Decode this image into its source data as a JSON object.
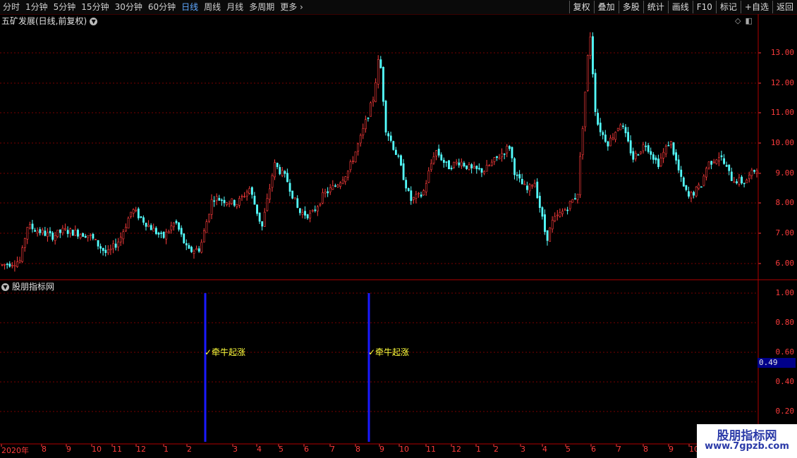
{
  "toolbar": {
    "periods": [
      "分时",
      "1分钟",
      "5分钟",
      "15分钟",
      "30分钟",
      "60分钟",
      "日线",
      "周线",
      "月线",
      "多周期",
      "更多"
    ],
    "active_period": "日线",
    "more_chevron": "›",
    "buttons": [
      "复权",
      "叠加",
      "多股",
      "统计",
      "画线",
      "F10",
      "标记",
      "+自选",
      "返回"
    ]
  },
  "main_chart": {
    "title": "五矿发展(日线,前复权)",
    "icons": [
      "chevron-down-icon",
      "diamond-icon",
      "panel-toggle-icon"
    ]
  },
  "indicator": {
    "title": "股朋指标网",
    "current_value": "0.49",
    "signal_label": "牵牛起涨",
    "signal_check": "✓"
  },
  "watermark": {
    "title": "股朋指标网",
    "url": "www.7gpzb.com"
  },
  "colors": {
    "up": "#ff3c3c",
    "down": "#54ffff",
    "axis": "#ff3c3c",
    "grid": "#7a0000",
    "signal_bar": "#1a1aff",
    "signal_text": "#ffff3c",
    "active_period": "#5fa8ff"
  },
  "chart_data": [
    {
      "type": "candlestick",
      "title": "五矿发展(日线,前复权)",
      "y_ticks": [
        "13.00",
        "12.00",
        "11.00",
        "10.00",
        "9.00",
        "8.00",
        "7.00",
        "6.00"
      ],
      "ylim": [
        5.6,
        14.0
      ],
      "x_tick_labels": [
        "2020年",
        "8",
        "9",
        "10",
        "11",
        "12",
        "1",
        "2",
        "3",
        "4",
        "5",
        "6",
        "7",
        "8",
        "9",
        "10",
        "11",
        "12",
        "1",
        "2",
        "3",
        "4",
        "5",
        "6",
        "7",
        "8",
        "9",
        "10",
        "1"
      ],
      "price_path": [
        [
          0,
          5.95
        ],
        [
          3,
          6.1
        ],
        [
          4,
          7.25
        ],
        [
          8,
          6.9
        ],
        [
          10,
          7.1
        ],
        [
          14,
          6.95
        ],
        [
          17,
          6.3
        ],
        [
          19,
          6.8
        ],
        [
          21,
          7.8
        ],
        [
          24,
          7.2
        ],
        [
          26,
          6.85
        ],
        [
          28,
          7.4
        ],
        [
          30,
          6.4
        ],
        [
          32,
          6.5
        ],
        [
          34,
          8.2
        ],
        [
          38,
          8.0
        ],
        [
          40,
          8.5
        ],
        [
          42,
          7.2
        ],
        [
          44,
          9.3
        ],
        [
          46,
          8.8
        ],
        [
          48,
          7.7
        ],
        [
          50,
          7.6
        ],
        [
          52,
          8.3
        ],
        [
          54,
          8.6
        ],
        [
          56,
          9.1
        ],
        [
          58,
          10.2
        ],
        [
          60,
          11.5
        ],
        [
          61,
          13.0
        ],
        [
          62,
          10.5
        ],
        [
          64,
          9.5
        ],
        [
          66,
          8.1
        ],
        [
          68,
          8.3
        ],
        [
          70,
          9.8
        ],
        [
          72,
          9.2
        ],
        [
          74,
          9.4
        ],
        [
          76,
          9.1
        ],
        [
          78,
          9.1
        ],
        [
          80,
          9.5
        ],
        [
          82,
          9.9
        ],
        [
          83,
          8.9
        ],
        [
          85,
          8.4
        ],
        [
          86,
          8.8
        ],
        [
          87,
          7.8
        ],
        [
          88,
          6.8
        ],
        [
          89,
          7.4
        ],
        [
          91,
          7.8
        ],
        [
          93,
          8.3
        ],
        [
          94,
          11.0
        ],
        [
          95,
          13.8
        ],
        [
          96,
          10.8
        ],
        [
          97,
          10.3
        ],
        [
          98,
          10.0
        ],
        [
          100,
          10.7
        ],
        [
          102,
          9.5
        ],
        [
          104,
          10.0
        ],
        [
          106,
          9.3
        ],
        [
          108,
          10.1
        ],
        [
          110,
          8.6
        ],
        [
          111,
          8.2
        ],
        [
          113,
          8.6
        ],
        [
          114,
          9.3
        ],
        [
          116,
          9.6
        ],
        [
          118,
          8.8
        ],
        [
          120,
          8.7
        ],
        [
          122,
          9.2
        ]
      ],
      "visible_max": "13.8",
      "visible_min": "5.9"
    },
    {
      "type": "bar",
      "title": "股朋指标网",
      "y_ticks": [
        "1.00",
        "0.80",
        "0.60",
        "0.40",
        "0.20"
      ],
      "ylim": [
        0.0,
        1.05
      ],
      "signals": [
        {
          "value": 1.0,
          "label": "牵牛起涨"
        },
        {
          "value": 1.0,
          "label": "牵牛起涨"
        }
      ]
    }
  ]
}
